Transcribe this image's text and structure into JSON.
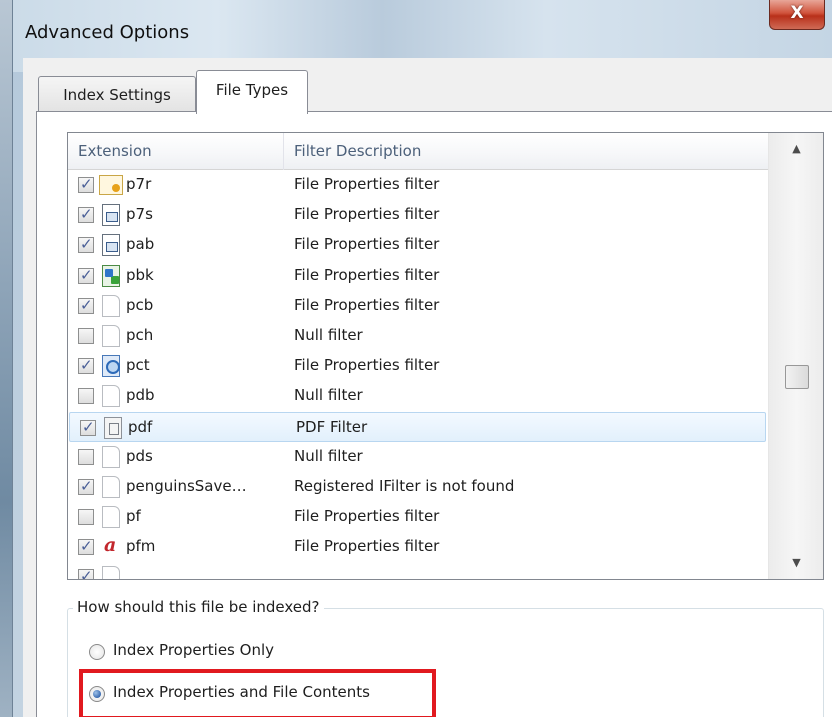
{
  "window": {
    "title": "Advanced Options",
    "close_label": "X"
  },
  "tabs": [
    {
      "label": "Index Settings",
      "active": false
    },
    {
      "label": "File Types",
      "active": true
    }
  ],
  "list": {
    "columns": [
      "Extension",
      "Filter Description"
    ],
    "rows": [
      {
        "checked": true,
        "icon": "certificate-icon",
        "ext": "p7r",
        "desc": "File Properties filter"
      },
      {
        "checked": true,
        "icon": "card-file-icon",
        "ext": "p7s",
        "desc": "File Properties filter"
      },
      {
        "checked": true,
        "icon": "card-file-icon",
        "ext": "pab",
        "desc": "File Properties filter"
      },
      {
        "checked": true,
        "icon": "network-connection-icon",
        "ext": "pbk",
        "desc": "File Properties filter"
      },
      {
        "checked": true,
        "icon": "blank-file-icon",
        "ext": "pcb",
        "desc": "File Properties filter"
      },
      {
        "checked": false,
        "icon": "blank-file-icon",
        "ext": "pch",
        "desc": "Null filter"
      },
      {
        "checked": true,
        "icon": "picture-file-icon",
        "ext": "pct",
        "desc": "File Properties filter"
      },
      {
        "checked": false,
        "icon": "blank-file-icon",
        "ext": "pdb",
        "desc": "Null filter"
      },
      {
        "checked": true,
        "icon": "pdf-file-icon",
        "ext": "pdf",
        "desc": "PDF Filter",
        "selected": true
      },
      {
        "checked": false,
        "icon": "blank-file-icon",
        "ext": "pds",
        "desc": "Null filter"
      },
      {
        "checked": true,
        "icon": "blank-file-icon",
        "ext": "penguinsSave…",
        "desc": "Registered IFilter is not found"
      },
      {
        "checked": false,
        "icon": "blank-file-icon",
        "ext": "pf",
        "desc": "File Properties filter"
      },
      {
        "checked": true,
        "icon": "font-file-icon",
        "ext": "pfm",
        "desc": "File Properties filter"
      },
      {
        "checked": true,
        "icon": "blank-file-icon",
        "ext": "",
        "desc": "",
        "partial": true
      }
    ]
  },
  "index_group": {
    "label": "How should this file be indexed?",
    "options": [
      {
        "label": "Index Properties Only",
        "selected": false
      },
      {
        "label": "Index Properties and File Contents",
        "selected": true
      }
    ]
  },
  "colors": {
    "highlight_box": "#e1191f",
    "selection": "#e2f0fc"
  }
}
